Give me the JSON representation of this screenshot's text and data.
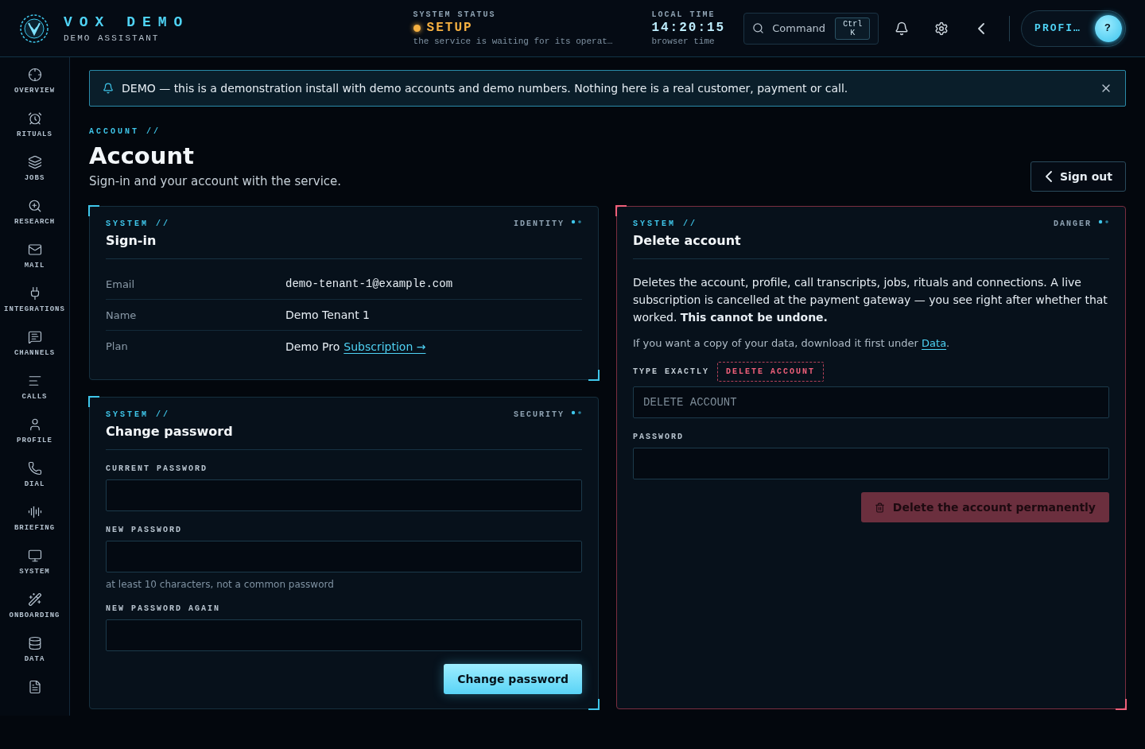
{
  "header": {
    "brand": {
      "title": "VOX DEMO",
      "subtitle": "DEMO ASSISTANT"
    },
    "status": {
      "label": "SYSTEM STATUS",
      "value": "SETUP",
      "note": "the service is waiting for its operat…"
    },
    "time": {
      "label": "LOCAL TIME",
      "value": "14:20:15",
      "note": "browser time"
    },
    "command": {
      "label": "Command",
      "shortcut": "Ctrl K"
    },
    "profile": {
      "label": "PROFI…",
      "avatar": "?"
    }
  },
  "sidebar": {
    "items": [
      {
        "kind": "labeled",
        "label": "OVERVIEW"
      },
      {
        "kind": "labeled",
        "label": "RITUALS"
      },
      {
        "kind": "labeled",
        "label": "JOBS"
      },
      {
        "kind": "labeled",
        "label": "RESEARCH"
      },
      {
        "kind": "labeled",
        "label": "MAIL"
      },
      {
        "kind": "labeled",
        "label": "INTEGRATIONS"
      },
      {
        "kind": "labeled",
        "label": "CHANNELS"
      },
      {
        "kind": "labeled",
        "label": "CALLS"
      },
      {
        "kind": "labeled",
        "label": "PROFILE"
      },
      {
        "kind": "labeled",
        "label": "DIAL"
      },
      {
        "kind": "labeled",
        "label": "BRIEFING"
      },
      {
        "kind": "labeled",
        "label": "SYSTEM"
      },
      {
        "kind": "labeled",
        "label": "ONBOARDING"
      },
      {
        "kind": "labeled",
        "label": "DATA"
      },
      {
        "kind": "icon"
      }
    ]
  },
  "banner": {
    "text": "DEMO — this is a demonstration install with demo accounts and demo numbers. Nothing here is a real customer, payment or call."
  },
  "page": {
    "eyebrow": "ACCOUNT //",
    "title": "Account",
    "subtitle": "Sign-in and your account with the service.",
    "sign_out": "Sign out"
  },
  "signin": {
    "eyebrow": "SYSTEM //",
    "title": "Sign-in",
    "tag": "IDENTITY",
    "rows": [
      {
        "label": "Email",
        "value": "demo-tenant-1@example.com",
        "kind": "mono"
      },
      {
        "label": "Name",
        "value": "Demo Tenant 1",
        "kind": "text"
      },
      {
        "label": "Plan",
        "value": "Demo Pro",
        "kind": "text",
        "link": "Subscription →"
      }
    ]
  },
  "password": {
    "eyebrow": "SYSTEM //",
    "title": "Change password",
    "tag": "SECURITY",
    "fields": [
      {
        "label": "CURRENT PASSWORD"
      },
      {
        "label": "NEW PASSWORD",
        "hint": "at least 10 characters, not a common password"
      },
      {
        "label": "NEW PASSWORD AGAIN"
      }
    ],
    "button": "Change password"
  },
  "danger": {
    "eyebrow": "SYSTEM //",
    "title": "Delete account",
    "tag": "DANGER",
    "description": "Deletes the account, profile, call transcripts, jobs, rituals and connections. A live subscription is cancelled at the payment gateway — you see right after whether that worked. **This cannot be undone.**",
    "note_before": "If you want a copy of your data, download it first under ",
    "note_link": "Data",
    "note_after": ".",
    "confirm_label": "TYPE EXACTLY",
    "confirm_phrase": "DELETE ACCOUNT",
    "confirm_placeholder": "DELETE ACCOUNT",
    "password_label": "PASSWORD",
    "button": "Delete the account permanently"
  }
}
